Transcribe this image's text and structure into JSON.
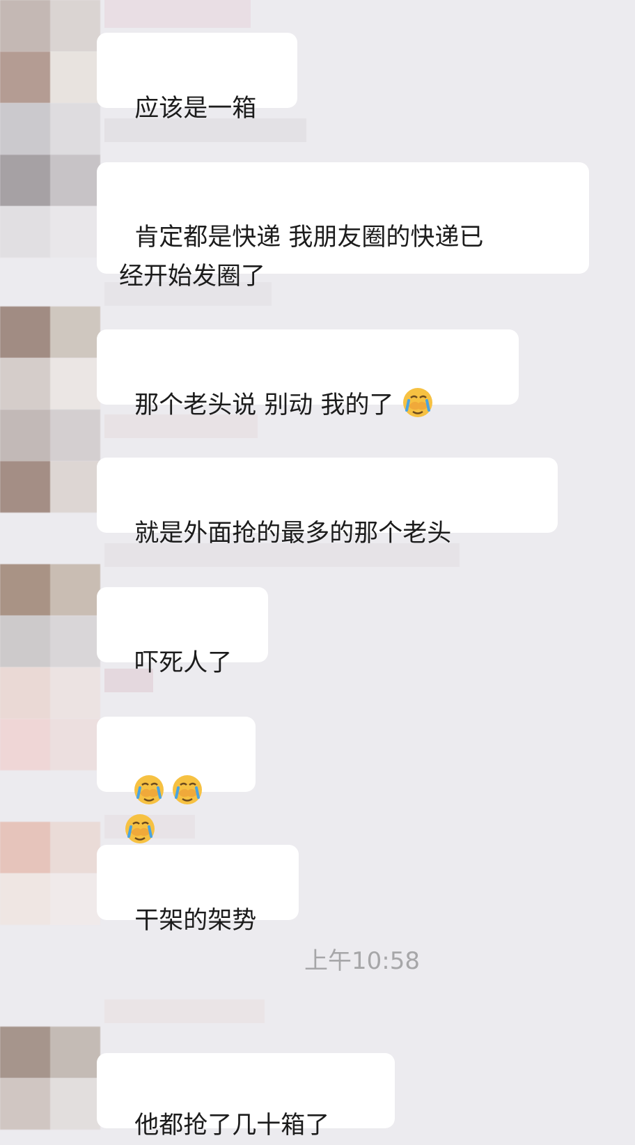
{
  "chat": {
    "timestamp": "上午10:58",
    "messages": [
      {
        "text": "应该是一箱"
      },
      {
        "text": "肯定都是快递 我朋友圈的快递已\n经开始发圈了"
      },
      {
        "text": "那个老头说 别动 我的了 ",
        "emoji": "facepalm-crying-emoji"
      },
      {
        "text": "就是外面抢的最多的那个老头"
      },
      {
        "text": "吓死人了"
      },
      {
        "text": "",
        "emoji_count": 3,
        "emoji": "facepalm-crying-emoji"
      },
      {
        "text": "干架的架势"
      },
      {
        "text": "他都抢了几十箱了"
      }
    ]
  },
  "colors": {
    "background": "#ecebef",
    "bubble": "#ffffff",
    "text": "#1c1c1c",
    "timestamp": "#a6a6a8",
    "emoji_face": "#f6c142"
  }
}
